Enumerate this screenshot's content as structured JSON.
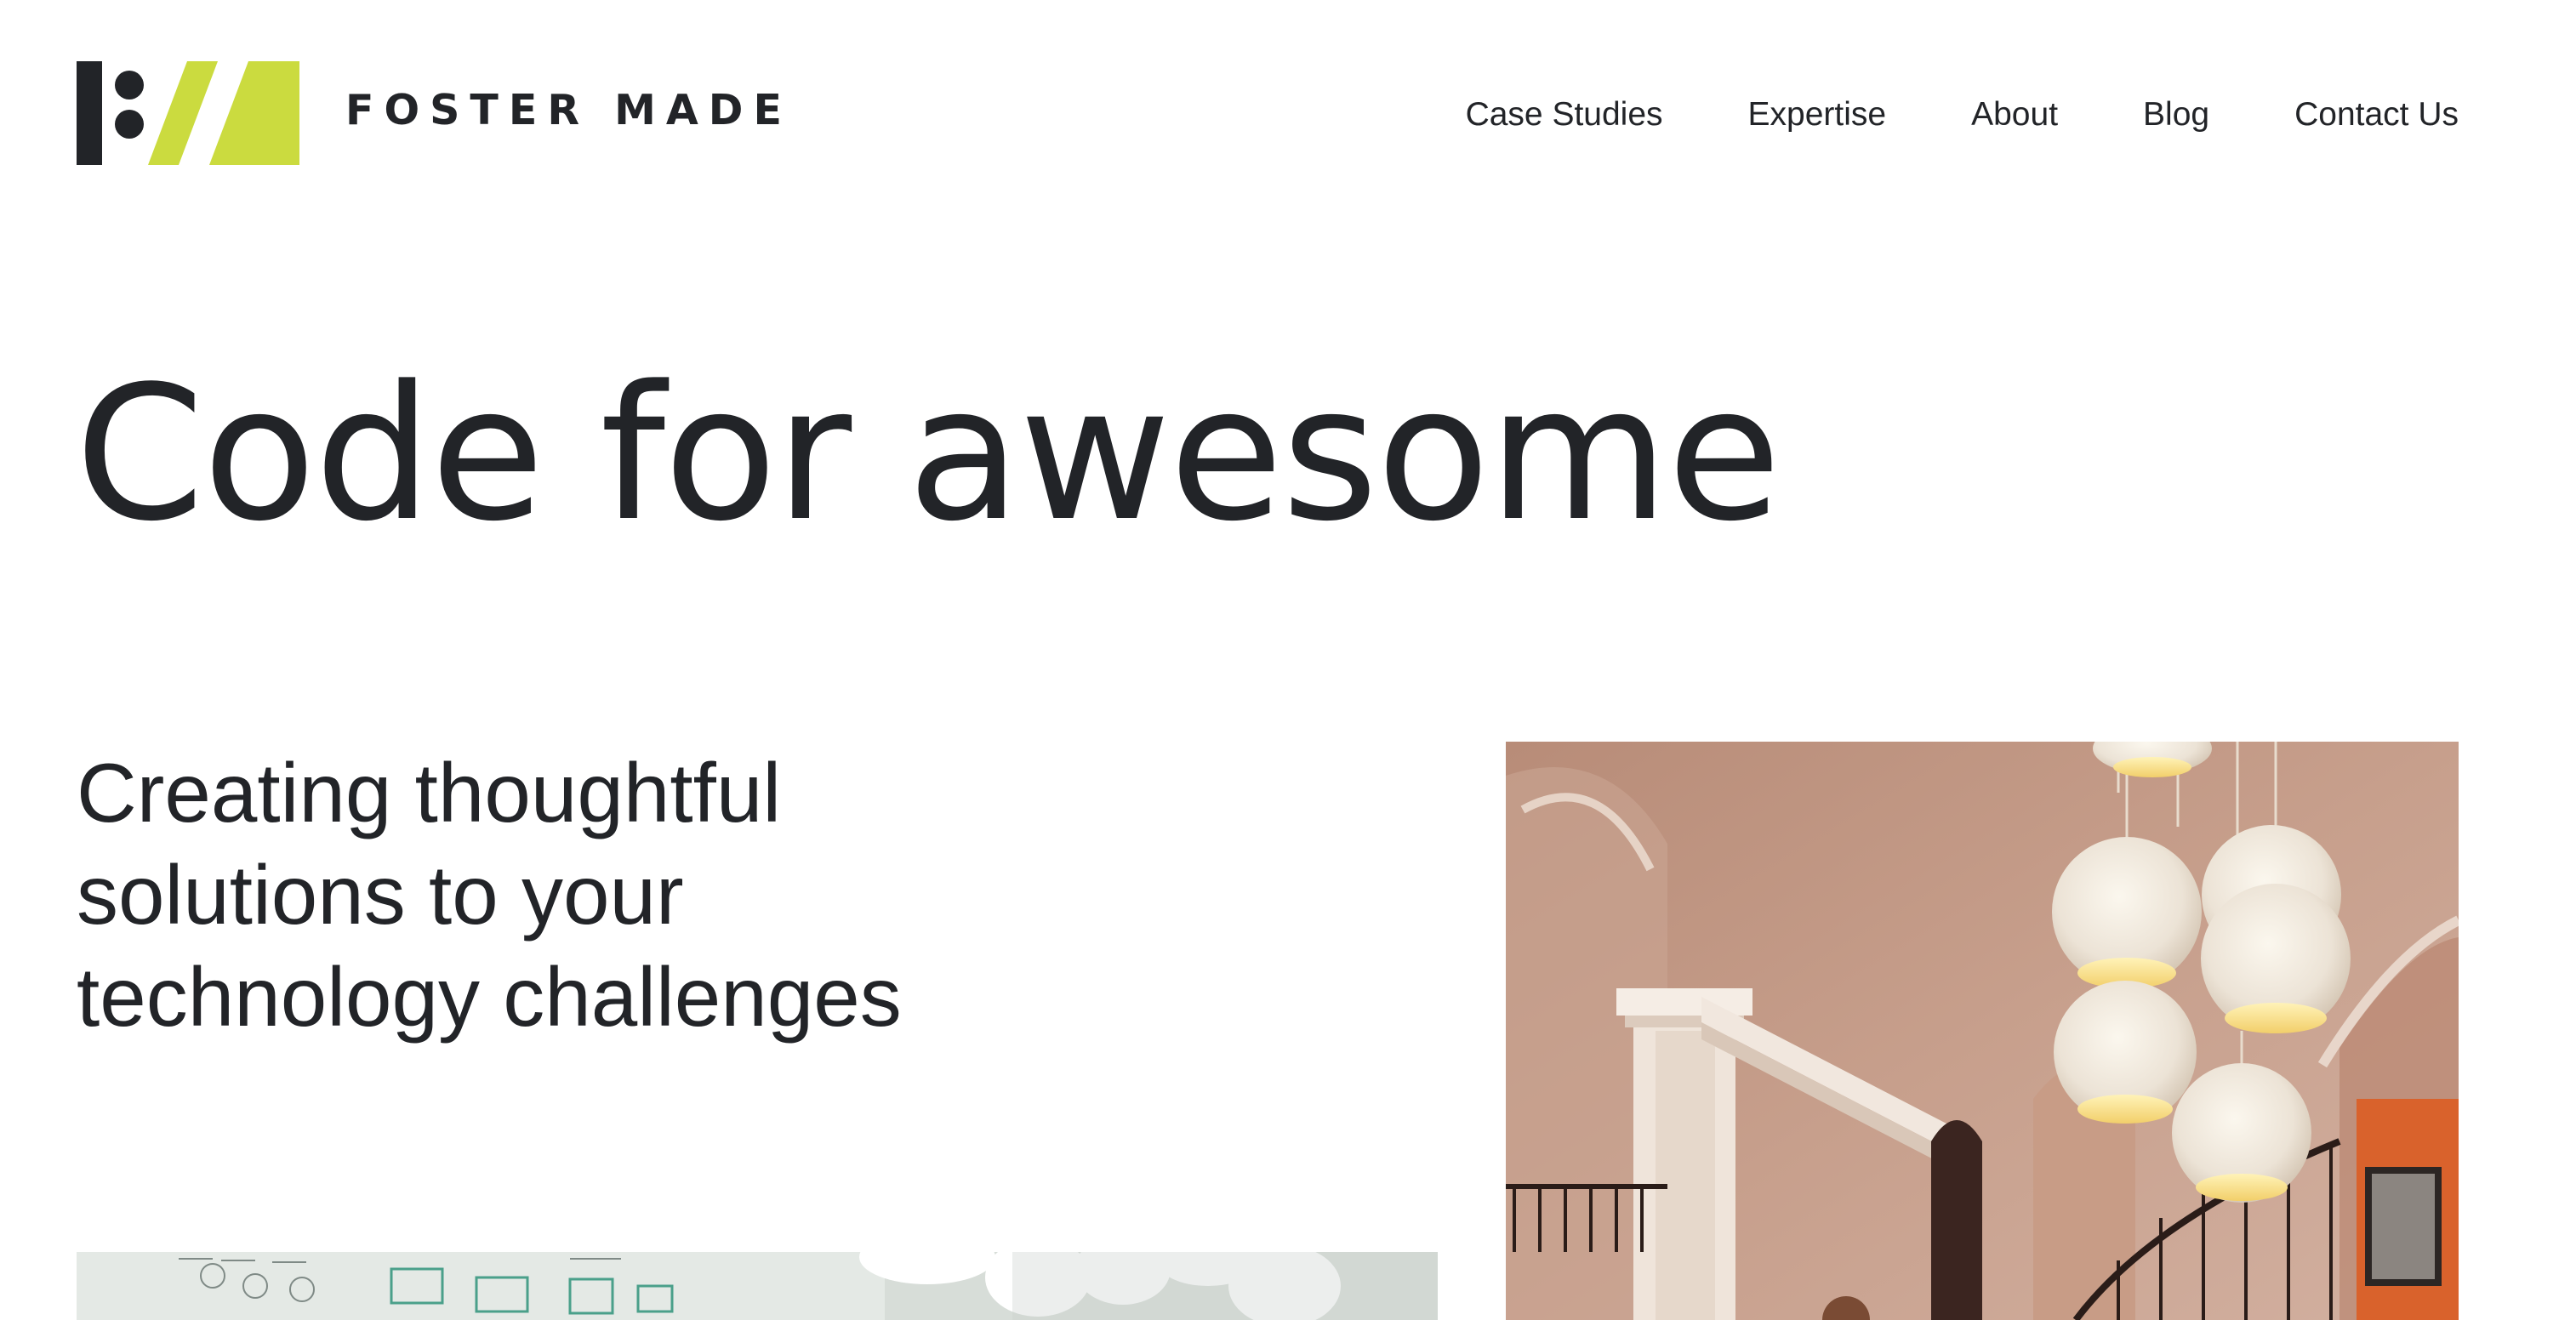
{
  "brand": {
    "name": "FOSTER MADE",
    "accent_color": "#cbdb3f",
    "dark_color": "#222428"
  },
  "nav": {
    "items": [
      {
        "label": "Case Studies"
      },
      {
        "label": "Expertise"
      },
      {
        "label": "About"
      },
      {
        "label": "Blog"
      },
      {
        "label": "Contact Us"
      }
    ]
  },
  "hero": {
    "title": "Code for awesome",
    "subtitle": "Creating thoughtful solutions to your technology challenges"
  },
  "images": {
    "right": {
      "subject": "interior-arches-pendant-lamps-photo"
    },
    "left": {
      "subject": "whiteboard-office-photo"
    }
  }
}
